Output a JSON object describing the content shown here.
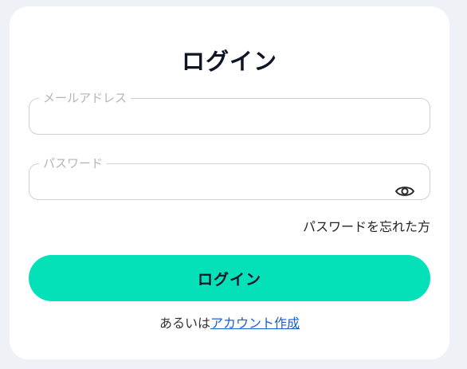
{
  "login_form": {
    "title": "ログイン",
    "email": {
      "label": "メールアドレス",
      "value": ""
    },
    "password": {
      "label": "パスワード",
      "value": "",
      "toggle_icon": "eye-icon"
    },
    "forgot_password_label": "パスワードを忘れた方",
    "submit_label": "ログイン",
    "alternative_prefix": "あるいは",
    "create_account_label": "アカウント作成"
  },
  "colors": {
    "background": "#eef2f7",
    "card": "#ffffff",
    "accent": "#04e1b8",
    "link": "#1a5fd6"
  }
}
